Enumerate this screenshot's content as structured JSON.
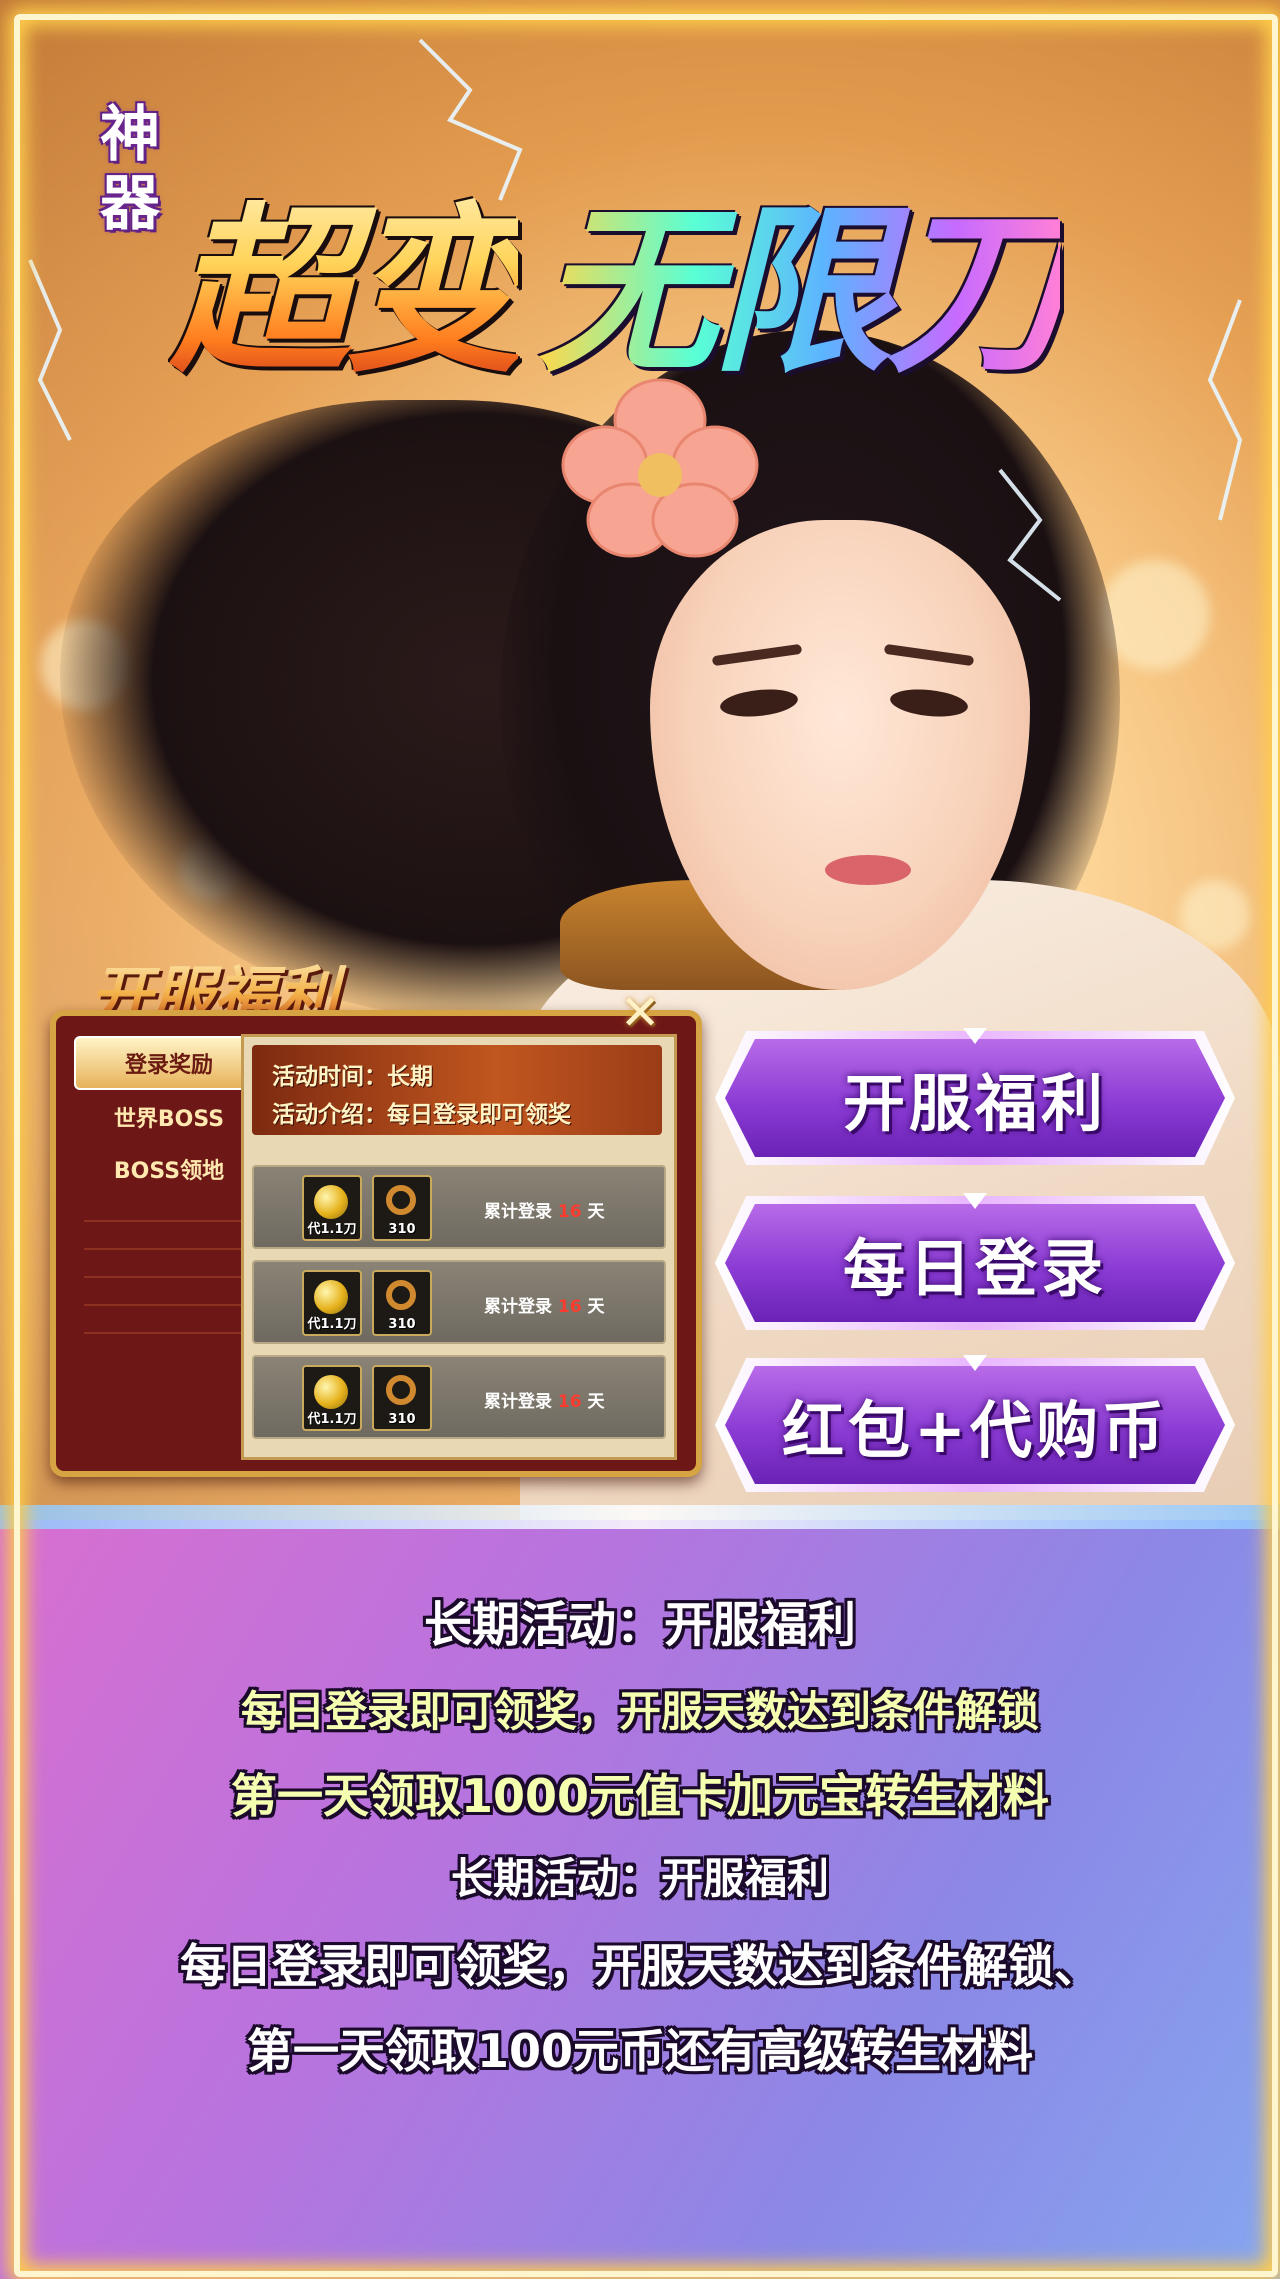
{
  "title": {
    "side_tag_top": "神",
    "side_tag_bottom": "器",
    "main_part1": "超变",
    "main_part2": "无限刀"
  },
  "panel": {
    "heading": "开服福利",
    "sidebar": [
      "登录奖励",
      "世界BOSS",
      "BOSS领地"
    ],
    "activity_time": "活动时间：长期",
    "activity_desc": "活动介绍：每日登录即可领奖",
    "rows": [
      {
        "item1": "代1.1刀",
        "item2": "310",
        "label": "累计登录",
        "days": "16",
        "unit": "天"
      },
      {
        "item1": "代1.1刀",
        "item2": "310",
        "label": "累计登录",
        "days": "16",
        "unit": "天"
      },
      {
        "item1": "代1.1刀",
        "item2": "310",
        "label": "累计登录",
        "days": "16",
        "unit": "天"
      }
    ]
  },
  "buttons": [
    "开服福利",
    "每日登录",
    "红包+代购币"
  ],
  "info": {
    "heading1": "长期活动：开服福利",
    "line1": "每日登录即可领奖，开服天数达到条件解锁",
    "line2": "第一天领取1000元值卡加元宝转生材料",
    "heading2": "长期活动：开服福利",
    "line3": "每日登录即可领奖，开服天数达到条件解锁、",
    "line4": "第一天领取100元币还有高级转生材料"
  },
  "colors": {
    "frame_glow": "#ffcd4a",
    "button_purple": "#8b3bd4",
    "panel_red": "#6e1717",
    "info_gradient_start": "#d86fd0",
    "info_gradient_end": "#86a6ef"
  }
}
